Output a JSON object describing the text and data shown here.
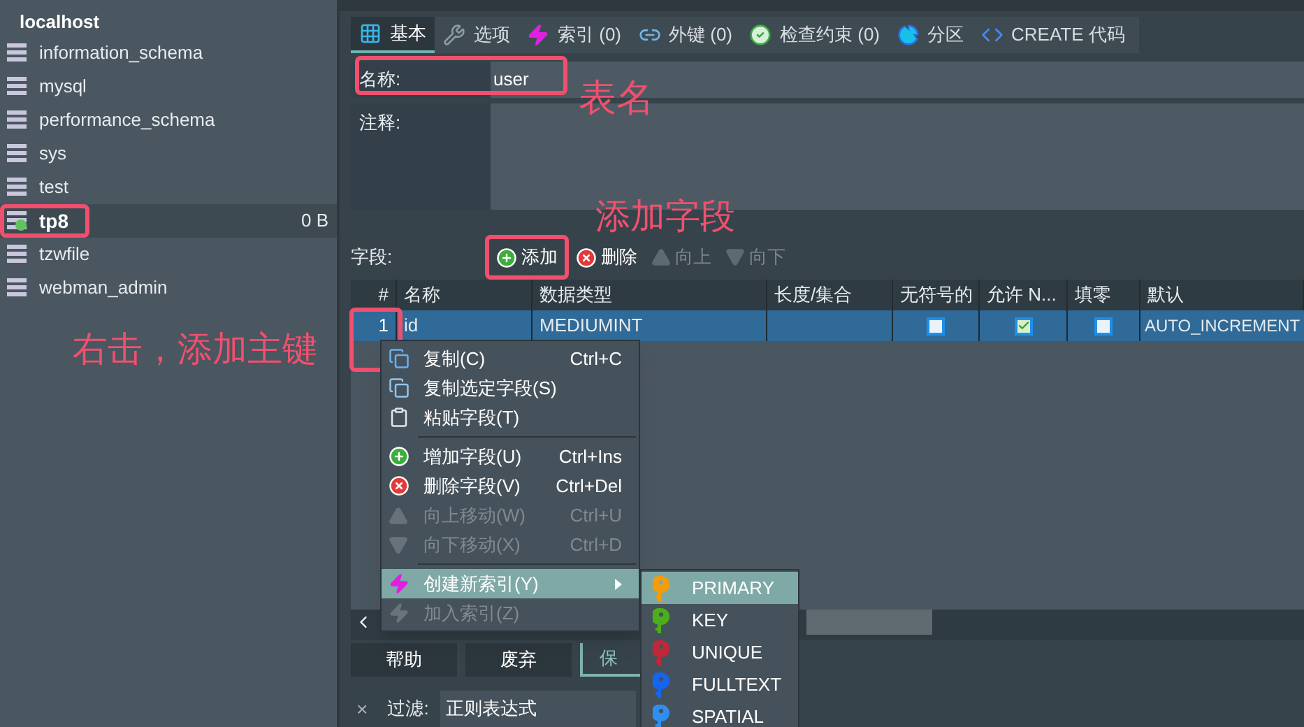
{
  "sidebar": {
    "connection": "localhost",
    "databases": [
      {
        "name": "information_schema",
        "selected": false,
        "highlighted": false
      },
      {
        "name": "mysql",
        "selected": false,
        "highlighted": false
      },
      {
        "name": "performance_schema",
        "selected": false,
        "highlighted": false
      },
      {
        "name": "sys",
        "selected": false,
        "highlighted": false
      },
      {
        "name": "test",
        "selected": false,
        "highlighted": false
      },
      {
        "name": "tp8",
        "selected": true,
        "highlighted": true,
        "size": "0 B"
      },
      {
        "name": "tzwfile",
        "selected": false,
        "highlighted": false
      },
      {
        "name": "webman_admin",
        "selected": false,
        "highlighted": false
      }
    ]
  },
  "tabs": [
    {
      "label": "基本",
      "selected": true
    },
    {
      "label": "选项",
      "selected": false
    },
    {
      "label": "索引 (0)",
      "selected": false
    },
    {
      "label": "外键 (0)",
      "selected": false
    },
    {
      "label": "检查约束 (0)",
      "selected": false
    },
    {
      "label": "分区",
      "selected": false
    },
    {
      "label": "CREATE 代码",
      "selected": false
    }
  ],
  "form": {
    "name_label": "名称:",
    "name_value": "user",
    "name_highlighted": true,
    "comment_label": "注释:"
  },
  "fields_toolbar": {
    "label": "字段:",
    "buttons": [
      {
        "label": "添加",
        "disabled": false,
        "highlighted": true
      },
      {
        "label": "删除",
        "disabled": false,
        "highlighted": false
      },
      {
        "label": "向上",
        "disabled": true,
        "highlighted": false
      },
      {
        "label": "向下",
        "disabled": true,
        "highlighted": false
      }
    ]
  },
  "table": {
    "columns": [
      "#",
      "名称",
      "数据类型",
      "长度/集合",
      "无符号的",
      "允许 N...",
      "填零",
      "默认"
    ],
    "rows": [
      {
        "number": "1",
        "name": "id",
        "type": "MEDIUMINT",
        "length": "",
        "unsigned": false,
        "allow_null": true,
        "zerofill": false,
        "default": "AUTO_INCREMENT",
        "selected": true,
        "highlighted": true
      }
    ]
  },
  "buttons": [
    {
      "label": "帮助",
      "selected": false
    },
    {
      "label": "废弃",
      "selected": false
    },
    {
      "label": "保",
      "selected": true
    }
  ],
  "filter": {
    "close": "×",
    "label": "过滤:",
    "value": "正则表达式"
  },
  "context_menu": [
    {
      "kind": "item",
      "label": "复制(C)",
      "shortcut": "Ctrl+C",
      "disabled": false,
      "selected": false
    },
    {
      "kind": "item",
      "label": "复制选定字段(S)",
      "disabled": false,
      "selected": false
    },
    {
      "kind": "item",
      "label": "粘贴字段(T)",
      "disabled": false,
      "selected": false
    },
    {
      "kind": "separator"
    },
    {
      "kind": "item",
      "label": "增加字段(U)",
      "shortcut": "Ctrl+Ins",
      "disabled": false,
      "selected": false
    },
    {
      "kind": "item",
      "label": "删除字段(V)",
      "shortcut": "Ctrl+Del",
      "disabled": false,
      "selected": false
    },
    {
      "kind": "item",
      "label": "向上移动(W)",
      "shortcut": "Ctrl+U",
      "disabled": true,
      "selected": false
    },
    {
      "kind": "item",
      "label": "向下移动(X)",
      "shortcut": "Ctrl+D",
      "disabled": true,
      "selected": false
    },
    {
      "kind": "separator"
    },
    {
      "kind": "item",
      "label": "创建新索引(Y)",
      "disabled": false,
      "selected": true,
      "submenu": true
    },
    {
      "kind": "item",
      "label": "加入索引(Z)",
      "disabled": true,
      "selected": false
    }
  ],
  "submenu": [
    {
      "label": "PRIMARY",
      "color": "#f59c0b",
      "selected": true
    },
    {
      "label": "KEY",
      "color": "#4caf1a",
      "selected": false
    },
    {
      "label": "UNIQUE",
      "color": "#c0283a",
      "selected": false
    },
    {
      "label": "FULLTEXT",
      "color": "#1565f0",
      "selected": false
    },
    {
      "label": "SPATIAL",
      "color": "#2f8ff0",
      "selected": false
    }
  ],
  "annotations": [
    "表名",
    "添加字段",
    "右击，添加主键"
  ]
}
